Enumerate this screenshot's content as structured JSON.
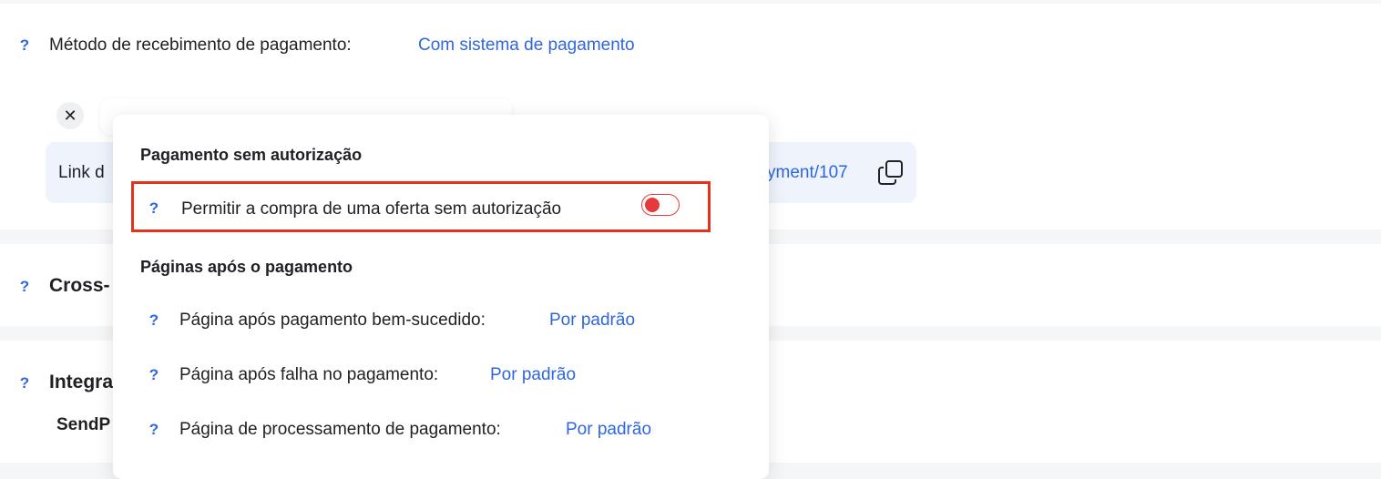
{
  "payment_method": {
    "label": "Método de recebimento de pagamento:",
    "value": "Com sistema de pagamento"
  },
  "payment_link": {
    "label_visible": "Link d",
    "url_visible": "yment/107"
  },
  "close_button": {
    "glyph": "✕"
  },
  "help_icon": {
    "glyph": "?",
    "name": "question-mark-icon"
  },
  "sections": {
    "cross_visible": "Cross-",
    "integra_visible": "Integra",
    "sendp_visible": "SendP"
  },
  "popover": {
    "heading_auth": "Pagamento sem autorização",
    "allow_purchase_label": "Permitir a compra de uma oferta sem autorização",
    "allow_purchase_enabled": false,
    "heading_pages": "Páginas após o pagamento",
    "pages": [
      {
        "label": "Página após pagamento bem-sucedido:",
        "value": "Por padrão"
      },
      {
        "label": "Página após falha no pagamento:",
        "value": "Por padrão"
      },
      {
        "label": "Página de processamento de pagamento:",
        "value": "Por padrão"
      }
    ]
  },
  "colors": {
    "accent": "#2f66e0",
    "danger": "#e5393b",
    "highlight_border": "#e2331f"
  }
}
